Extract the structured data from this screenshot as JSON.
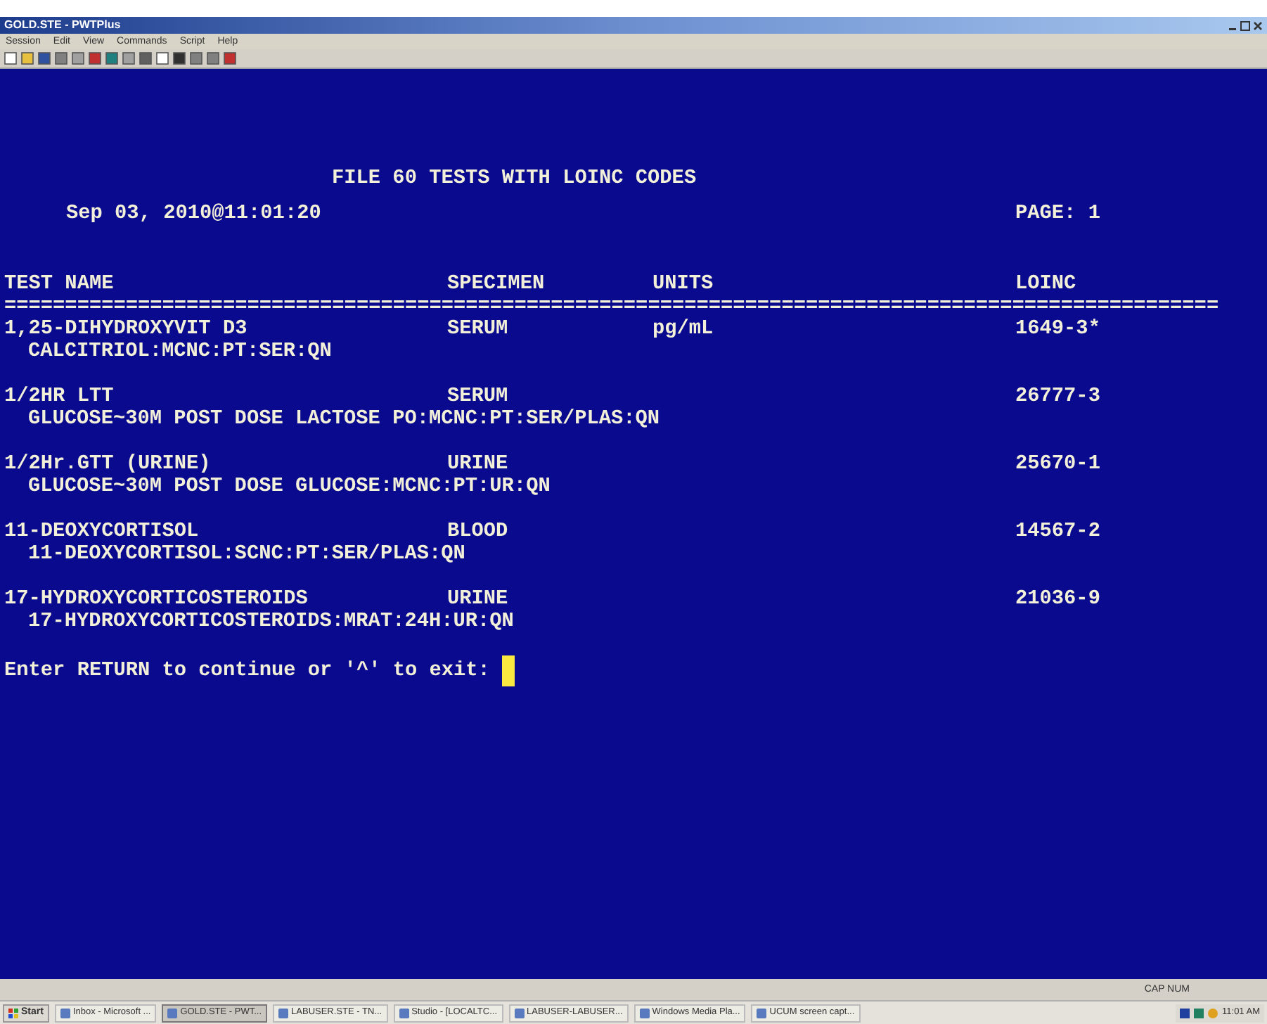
{
  "window": {
    "title": "GOLD.STE - PWTPlus"
  },
  "menu": [
    "Session",
    "Edit",
    "View",
    "Commands",
    "Script",
    "Help"
  ],
  "terminal": {
    "title": "FILE 60 TESTS WITH LOINC CODES",
    "date": "Sep 03, 2010@11:01:20",
    "page": "PAGE: 1",
    "columns": [
      "TEST NAME",
      "SPECIMEN",
      "UNITS",
      "LOINC"
    ],
    "rule": "====================================================================================================",
    "rows": [
      {
        "test_name": "1,25-DIHYDROXYVIT D3",
        "specimen": "SERUM",
        "units": "pg/mL",
        "loinc": "1649-3*",
        "description": "CALCITRIOL:MCNC:PT:SER:QN"
      },
      {
        "test_name": "1/2HR LTT",
        "specimen": "SERUM",
        "loinc": "26777-3",
        "description": "GLUCOSE~30M POST DOSE LACTOSE PO:MCNC:PT:SER/PLAS:QN"
      },
      {
        "test_name": "1/2Hr.GTT (URINE)",
        "specimen": "URINE",
        "loinc": "25670-1",
        "description": "GLUCOSE~30M POST DOSE GLUCOSE:MCNC:PT:UR:QN"
      },
      {
        "test_name": "11-DEOXYCORTISOL",
        "specimen": "BLOOD",
        "loinc": "14567-2",
        "description": "11-DEOXYCORTISOL:SCNC:PT:SER/PLAS:QN"
      },
      {
        "test_name": "17-HYDROXYCORTICOSTEROIDS",
        "specimen": "URINE",
        "loinc": "21036-9",
        "description": "17-HYDROXYCORTICOSTEROIDS:MRAT:24H:UR:QN"
      }
    ],
    "prompt": "Enter RETURN to continue or '^' to exit:"
  },
  "status_bar": {
    "indicators": "CAP NUM"
  },
  "taskbar": {
    "start": "Start",
    "items": [
      {
        "label": "Inbox - Microsoft ...",
        "selected": false
      },
      {
        "label": "GOLD.STE - PWT...",
        "selected": true
      },
      {
        "label": "LABUSER.STE - TN...",
        "selected": false
      },
      {
        "label": "Studio - [LOCALTC...",
        "selected": false
      },
      {
        "label": "LABUSER-LABUSER...",
        "selected": false
      },
      {
        "label": "Windows Media Pla...",
        "selected": false
      },
      {
        "label": "UCUM screen capt...",
        "selected": false
      }
    ],
    "clock": "11:01 AM"
  }
}
